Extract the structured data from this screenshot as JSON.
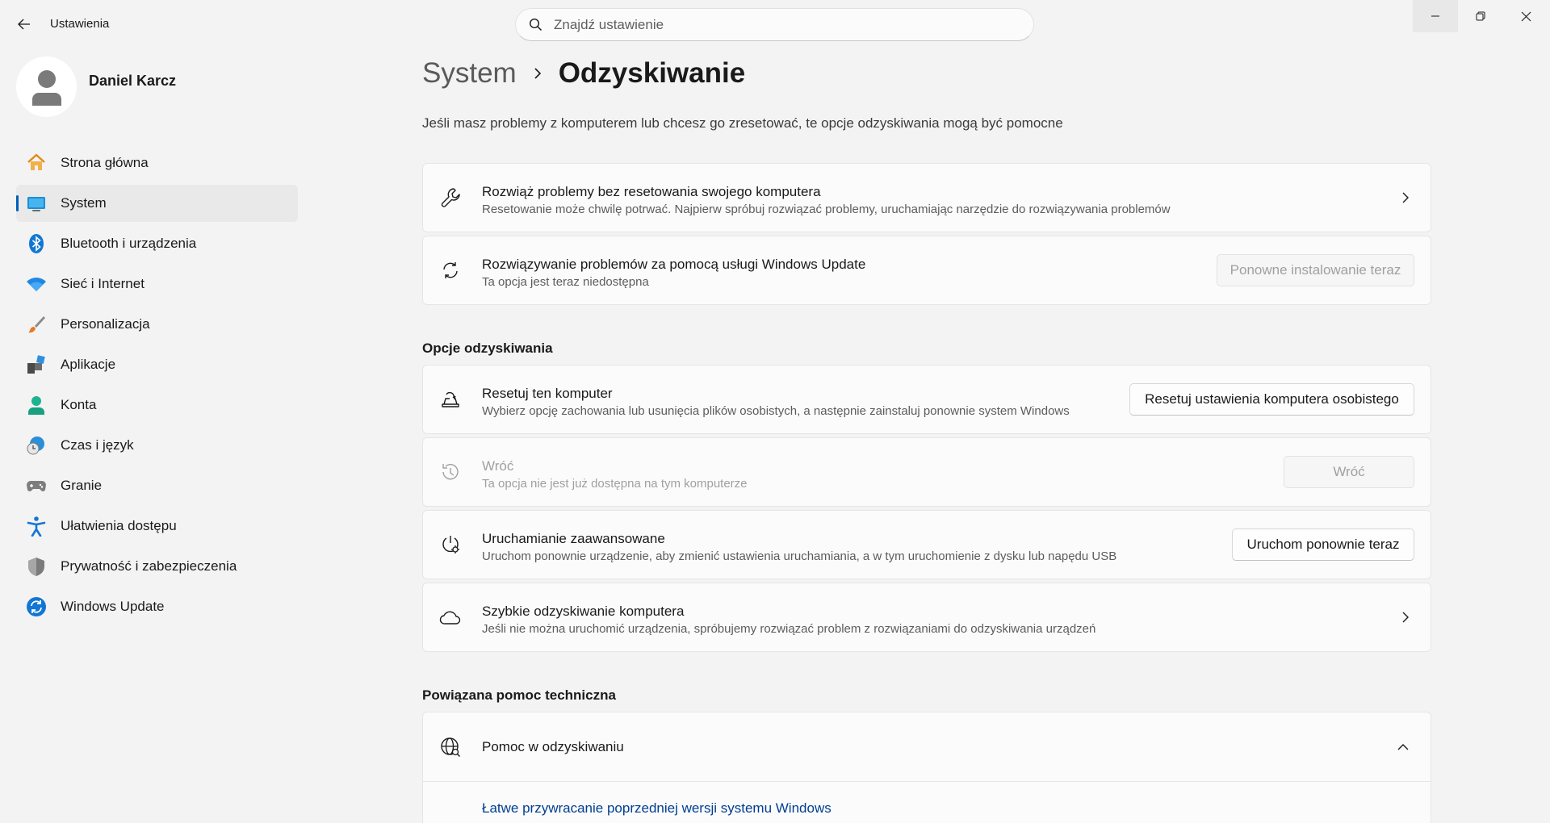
{
  "app": {
    "title": "Ustawienia"
  },
  "search": {
    "placeholder": "Znajdź ustawienie"
  },
  "user": {
    "name": "Daniel Karcz"
  },
  "nav": [
    {
      "label": "Strona główna",
      "icon": "home-icon"
    },
    {
      "label": "System",
      "icon": "system-display-icon"
    },
    {
      "label": "Bluetooth i urządzenia",
      "icon": "bluetooth-icon"
    },
    {
      "label": "Sieć i Internet",
      "icon": "wifi-icon"
    },
    {
      "label": "Personalizacja",
      "icon": "brush-icon"
    },
    {
      "label": "Aplikacje",
      "icon": "apps-icon"
    },
    {
      "label": "Konta",
      "icon": "account-icon"
    },
    {
      "label": "Czas i język",
      "icon": "time-language-icon"
    },
    {
      "label": "Granie",
      "icon": "gamepad-icon"
    },
    {
      "label": "Ułatwienia dostępu",
      "icon": "accessibility-icon"
    },
    {
      "label": "Prywatność i zabezpieczenia",
      "icon": "shield-icon"
    },
    {
      "label": "Windows Update",
      "icon": "windows-update-icon"
    }
  ],
  "breadcrumb": {
    "parent": "System",
    "current": "Odzyskiwanie"
  },
  "description": "Jeśli masz problemy z komputerem lub chcesz go zresetować, te opcje odzyskiwania mogą być pomocne",
  "cards_top": {
    "fix": {
      "title": "Rozwiąż problemy bez resetowania swojego komputera",
      "subtitle": "Resetowanie może chwilę potrwać. Najpierw spróbuj rozwiązać problemy, uruchamiając narzędzie do rozwiązywania problemów"
    },
    "wu": {
      "title": "Rozwiązywanie problemów za pomocą usługi Windows Update",
      "subtitle": "Ta opcja jest teraz niedostępna",
      "button": "Ponowne instalowanie teraz"
    }
  },
  "section_recovery": "Opcje odzyskiwania",
  "recovery": {
    "reset": {
      "title": "Resetuj ten komputer",
      "subtitle": "Wybierz opcję zachowania lub usunięcia plików osobistych, a następnie zainstaluj ponownie system Windows",
      "button": "Resetuj ustawienia komputera osobistego"
    },
    "goback": {
      "title": "Wróć",
      "subtitle": "Ta opcja nie jest już dostępna na tym komputerze",
      "button": "Wróć"
    },
    "advanced": {
      "title": "Uruchamianie zaawansowane",
      "subtitle": "Uruchom ponownie urządzenie, aby zmienić ustawienia uruchamiania, a w tym uruchomienie z dysku lub napędu USB",
      "button": "Uruchom ponownie teraz"
    },
    "quick": {
      "title": "Szybkie odzyskiwanie komputera",
      "subtitle": "Jeśli nie można uruchomić urządzenia, spróbujemy rozwiązać problem z rozwiązaniami do odzyskiwania urządzeń"
    }
  },
  "section_help": "Powiązana pomoc techniczna",
  "help": {
    "title": "Pomoc w odzyskiwaniu",
    "link": "Łatwe przywracanie poprzedniej wersji systemu Windows"
  },
  "colors": {
    "accent": "#005fb8",
    "link": "#003e92",
    "background": "#f3f3f3",
    "card": "#fbfbfb"
  }
}
